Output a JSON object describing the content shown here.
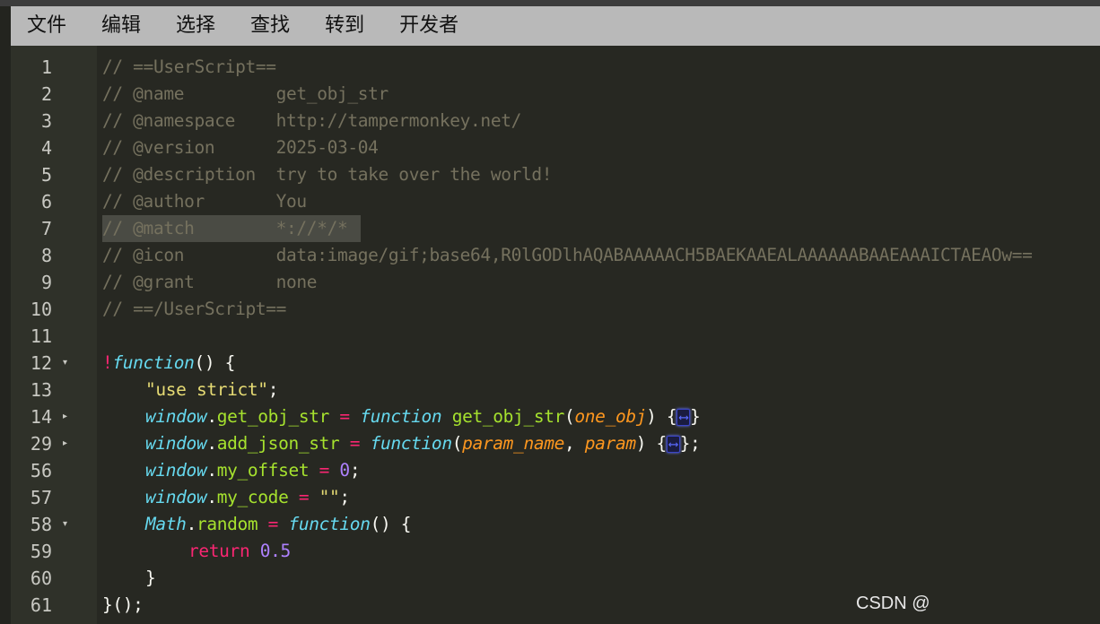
{
  "menu": [
    "文件",
    "编辑",
    "选择",
    "查找",
    "转到",
    "开发者"
  ],
  "code": {
    "line_numbers": [
      "1",
      "2",
      "3",
      "4",
      "5",
      "6",
      "7",
      "8",
      "9",
      "10",
      "11",
      "12",
      "13",
      "14",
      "29",
      "56",
      "57",
      "58",
      "59",
      "60",
      "61"
    ],
    "fold_markers": {
      "12": "▾",
      "14": "▸",
      "29": "▸",
      "58": "▾"
    },
    "header": [
      {
        "text": "// ==UserScript=="
      },
      {
        "text": "// @name         get_obj_str"
      },
      {
        "text": "// @namespace    http://tampermonkey.net/"
      },
      {
        "text": "// @version      2025-03-04"
      },
      {
        "text": "// @description  try to take over the world!"
      },
      {
        "text": "// @author       You"
      },
      {
        "text": "// @match        *://*/*"
      },
      {
        "text": "// @icon         data:image/gif;base64,R0lGODlhAQABAAAAACH5BAEKAAEALAAAAAABAAEAAAICTAEAOw=="
      },
      {
        "text": "// @grant        none"
      },
      {
        "text": "// ==/UserScript=="
      }
    ],
    "tokens": {
      "bang": "!",
      "function": "function",
      "parens": "()",
      "open_brace": " {",
      "use_strict": "\"use strict\"",
      "semicolon": ";",
      "window": "window",
      "dot": ".",
      "get_obj_str": "get_obj_str",
      "eq": " = ",
      "name_get_obj_str": "get_obj_str",
      "one_obj": "one_obj",
      "add_json_str": "add_json_str",
      "param_name": "param_name",
      "comma": ", ",
      "param": "param",
      "my_offset": "my_offset",
      "zero": "0",
      "my_code": "my_code",
      "empty_str": "\"\"",
      "math": "Math",
      "random": "random",
      "return": "return",
      "half": "0.5",
      "close_brace": "}",
      "iife_end": "}();",
      "fold_glyph": "⟷",
      "open_paren": "(",
      "close_paren": ")",
      "space": " "
    }
  },
  "watermark": "CSDN @"
}
